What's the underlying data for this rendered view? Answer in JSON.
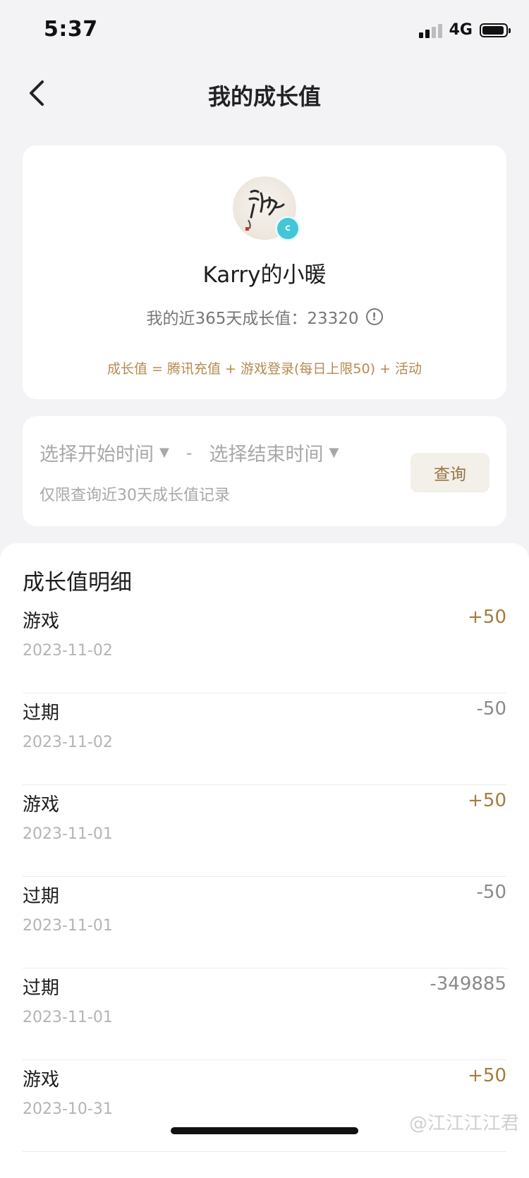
{
  "status": {
    "time": "5:37",
    "network": "4G"
  },
  "nav": {
    "title": "我的成长值"
  },
  "profile": {
    "username": "Karry的小暖",
    "growth_label": "我的近365天成长值：23320",
    "info_symbol": "!",
    "badge_text": "c",
    "formula": "成长值 = 腾讯充值 + 游戏登录(每日上限50) + 活动"
  },
  "query": {
    "start_placeholder": "选择开始时间",
    "end_placeholder": "选择结束时间",
    "dropdown_glyph": "▼",
    "separator": "-",
    "hint": "仅限查询近30天成长值记录",
    "button_label": "查询"
  },
  "details": {
    "title": "成长值明细",
    "records": [
      {
        "type": "游戏",
        "date": "2023-11-02",
        "value": "+50",
        "sign": "pos"
      },
      {
        "type": "过期",
        "date": "2023-11-02",
        "value": "-50",
        "sign": "neg"
      },
      {
        "type": "游戏",
        "date": "2023-11-01",
        "value": "+50",
        "sign": "pos"
      },
      {
        "type": "过期",
        "date": "2023-11-01",
        "value": "-50",
        "sign": "neg"
      },
      {
        "type": "过期",
        "date": "2023-11-01",
        "value": "-349885",
        "sign": "neg"
      },
      {
        "type": "游戏",
        "date": "2023-10-31",
        "value": "+50",
        "sign": "pos"
      }
    ]
  },
  "watermark": "@江江江江君"
}
